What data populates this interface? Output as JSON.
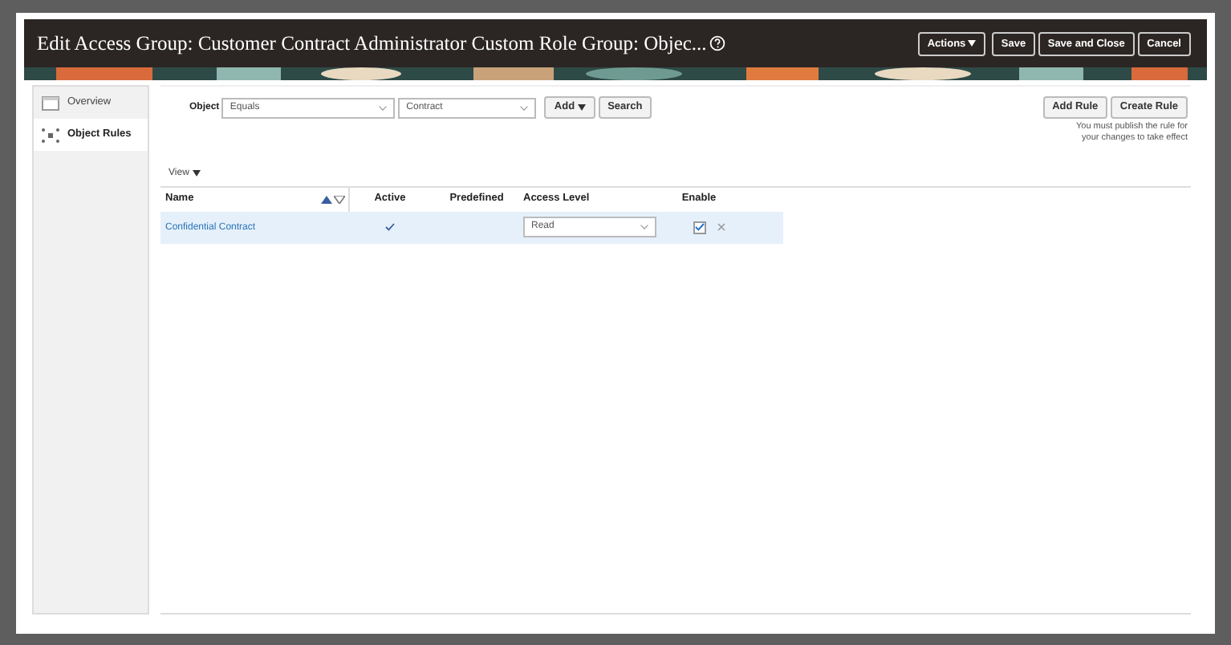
{
  "dialog": {
    "title": "Edit Access Group: Customer Contract Administrator Custom Role Group: Objec...",
    "header_buttons": [
      {
        "label": "Actions",
        "kind": "menu"
      },
      {
        "label": "Save",
        "kind": "plain"
      },
      {
        "label": "Save and Close",
        "kind": "plain"
      },
      {
        "label": "Cancel",
        "kind": "plain"
      }
    ]
  },
  "sidebar": {
    "items": [
      {
        "label": "Overview",
        "kind": "overview",
        "selected": false
      },
      {
        "label": "Object Rules",
        "kind": "rules",
        "selected": true
      }
    ]
  },
  "filter": {
    "label": "Object",
    "operator": "Equals",
    "value": "Contract",
    "add_button": "Add",
    "search_button": "Search"
  },
  "rule_buttons": [
    "Add Rule",
    "Create Rule"
  ],
  "note": "You must publish the rule for your changes to take effect",
  "view_menu": "View",
  "table": {
    "columns": [
      "Name",
      "Active",
      "Predefined",
      "Access Level",
      "Enable"
    ],
    "rows": [
      {
        "name": "Confidential Contract",
        "active": true,
        "access_level": "Read",
        "enabled": true,
        "selected": true
      }
    ]
  }
}
